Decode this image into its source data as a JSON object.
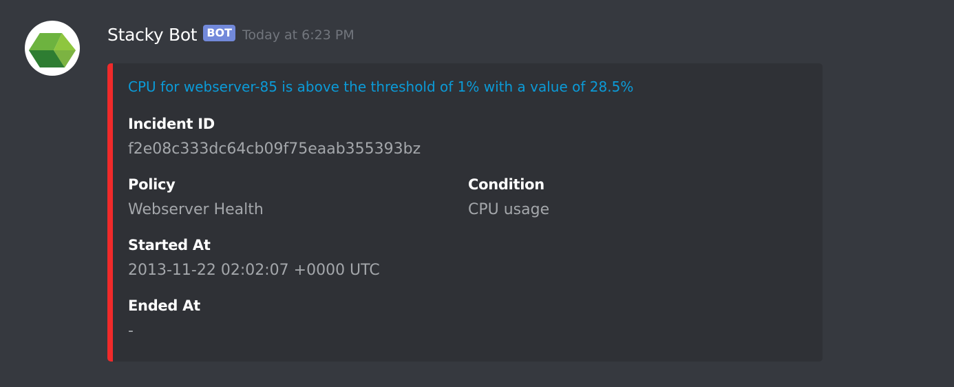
{
  "message": {
    "username": "Stacky Bot",
    "bot_tag": "BOT",
    "timestamp": "Today at 6:23 PM",
    "avatar_icon": "green-cube-icon"
  },
  "embed": {
    "accent_color": "#f02a2a",
    "title": "CPU for webserver-85 is above the threshold of 1% with a value of 28.5%",
    "fields": {
      "incident_id": {
        "name": "Incident ID",
        "value": "f2e08c333dc64cb09f75eaab355393bz"
      },
      "policy": {
        "name": "Policy",
        "value": "Webserver Health"
      },
      "condition": {
        "name": "Condition",
        "value": "CPU usage"
      },
      "started_at": {
        "name": "Started At",
        "value": "2013-11-22 02:02:07 +0000 UTC"
      },
      "ended_at": {
        "name": "Ended At",
        "value": "-"
      }
    }
  },
  "colors": {
    "background": "#36393f",
    "embed_background": "#2f3136",
    "link": "#0b9bd8",
    "bot_tag": "#7289da"
  }
}
